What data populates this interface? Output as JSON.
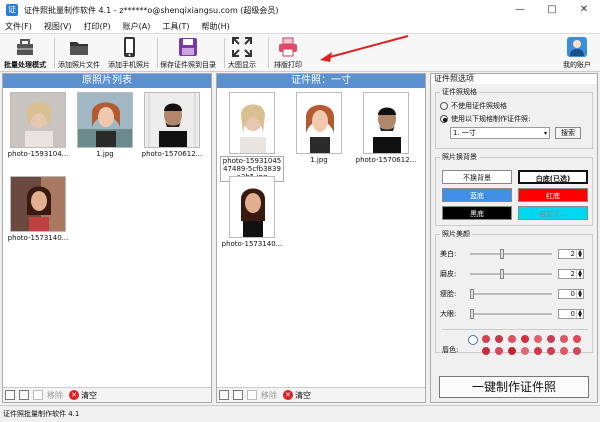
{
  "window": {
    "title": "证件照批量制作软件 4.1 - z******o@shenqixiangsu.com (超级会员)",
    "minimize": "—",
    "maximize": "□",
    "close": "✕"
  },
  "menu": [
    "文件(F)",
    "视图(V)",
    "打印(P)",
    "账户(A)",
    "工具(T)",
    "帮助(H)"
  ],
  "toolbar": {
    "batch_mode": "批量处理模式",
    "add_photo_file": "添加照片文件",
    "add_phone_photo": "添加手机照片",
    "save_to_dir": "保存证件照到目录",
    "large_display": "大图显示",
    "layout_print": "排版打印",
    "my_account": "我的账户"
  },
  "left": {
    "header": "原照片列表",
    "items": [
      "photo-1593104...",
      "1.jpg",
      "photo-1570612...",
      "photo-1573140..."
    ],
    "remove": "移除",
    "clear": "清空"
  },
  "middle": {
    "header": "证件照：一寸",
    "items": [
      "photo-1593104547489-5cfb3839a3b5.jpg",
      "1.jpg",
      "photo-1570612...",
      "photo-1573140..."
    ],
    "remove": "移除",
    "clear": "清空"
  },
  "right": {
    "header": "证件照选项",
    "spec_legend": "证件照规格",
    "spec_no": "不使用证件照规格",
    "spec_yes": "使用以下规格制作证件照:",
    "spec_value": "1. 一寸",
    "search": "搜索",
    "bg_legend": "照片换背景",
    "bg_none": "不换背景",
    "bg_white": "白底(已选)",
    "bg_blue": "蓝底",
    "bg_red": "红底",
    "bg_black": "黑底",
    "bg_custom": "自定义...",
    "beauty_legend": "照片美颜",
    "whiten": "美白:",
    "whiten_val": "2",
    "smooth": "磨皮:",
    "smooth_val": "2",
    "thin": "瘦脸:",
    "thin_val": "0",
    "eyes": "大眼:",
    "eyes_val": "0",
    "lip": "唇色:",
    "make_btn": "一键制作证件照"
  },
  "status": "证件照批量制作软件 4.1",
  "colors": {
    "accent": "#5a8fd0",
    "blue_bg": "#3f8fe6",
    "red_bg": "#ff0000",
    "black_bg": "#000000",
    "cyan_bg": "#00d8f0",
    "arrow": "#e02020"
  }
}
